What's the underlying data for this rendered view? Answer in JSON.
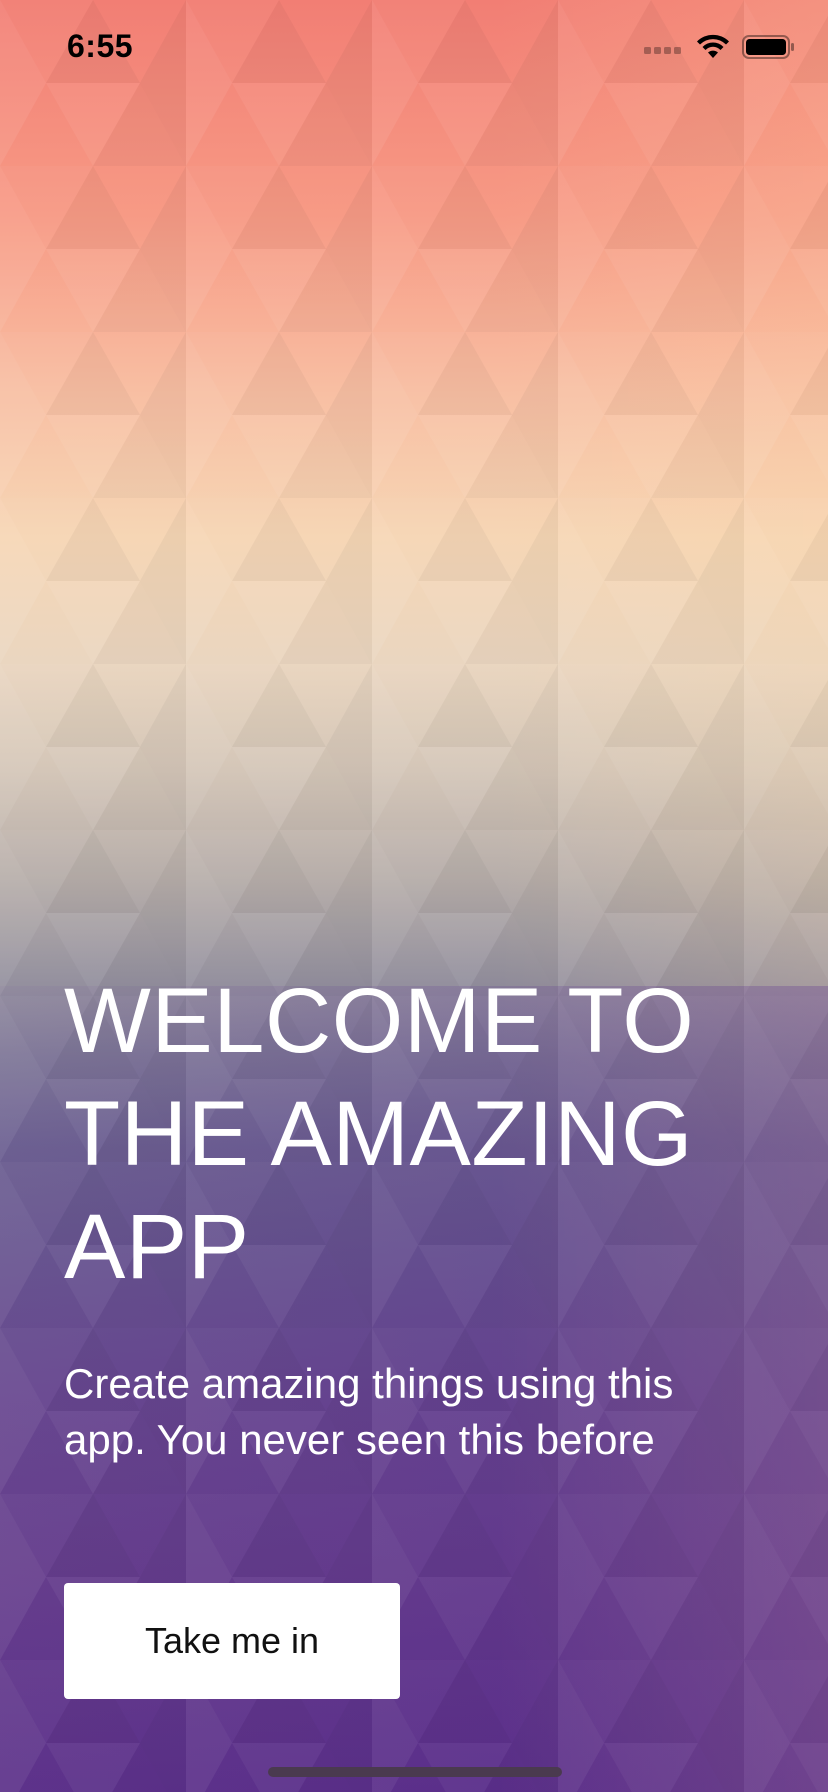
{
  "status_bar": {
    "time": "6:55",
    "icons": [
      "cellular-signal-icon",
      "wifi-icon",
      "battery-icon"
    ]
  },
  "welcome": {
    "headline_line1": "WELCOME TO",
    "headline_line2": "THE AMAZING",
    "headline_line3": "APP",
    "subtitle_line1": "Create amazing things using this",
    "subtitle_line2": "app. You never seen this before"
  },
  "cta": {
    "label": "Take me in"
  },
  "colors": {
    "gradient_top": "#f27e74",
    "gradient_mid": "#f6d6b5",
    "gradient_bottom": "#5c318a",
    "button_bg": "#ffffff",
    "button_text": "#111111",
    "text": "#ffffff"
  }
}
